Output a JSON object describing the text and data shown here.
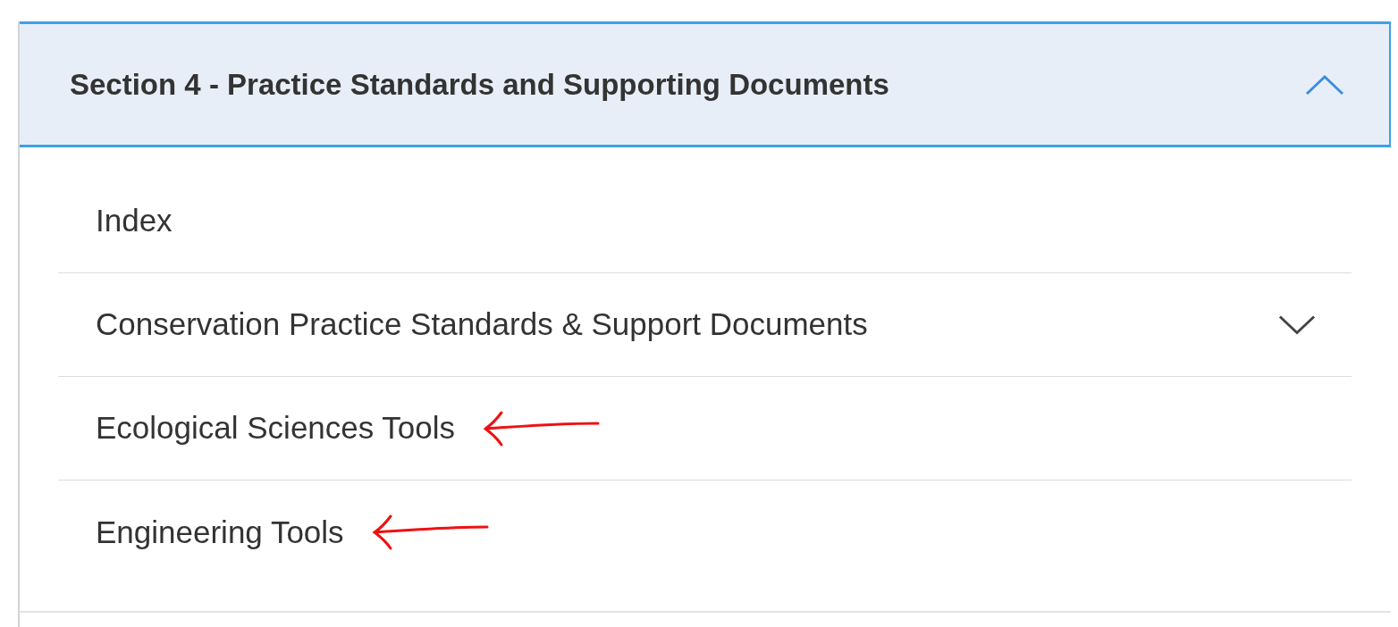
{
  "section": {
    "title": "Section 4 - Practice Standards and Supporting Documents",
    "expanded": true
  },
  "items": [
    {
      "label": "Index",
      "kind": "link",
      "annotated": false
    },
    {
      "label": "Conservation Practice Standards & Support Documents",
      "kind": "submenu",
      "annotated": false
    },
    {
      "label": "Ecological Sciences Tools",
      "kind": "link",
      "annotated": true
    },
    {
      "label": "Engineering Tools",
      "kind": "link",
      "annotated": true
    }
  ]
}
